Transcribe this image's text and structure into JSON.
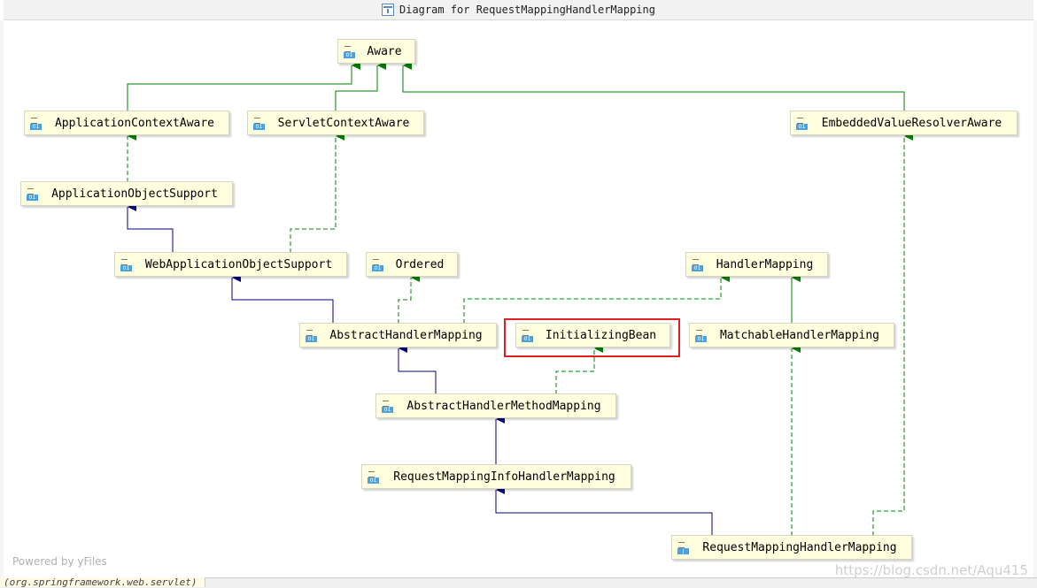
{
  "window": {
    "title": "Diagram for RequestMappingHandlerMapping"
  },
  "colors": {
    "extends": "#000080",
    "implements": "#008000",
    "highlight": "#e02020",
    "node_fill": "#ffffe0"
  },
  "nodes": {
    "aware": "Aware",
    "application_context_aware": "ApplicationContextAware",
    "servlet_context_aware": "ServletContextAware",
    "embedded_value_resolver_aware": "EmbeddedValueResolverAware",
    "application_object_support": "ApplicationObjectSupport",
    "web_application_object_support": "WebApplicationObjectSupport",
    "ordered": "Ordered",
    "handler_mapping": "HandlerMapping",
    "abstract_handler_mapping": "AbstractHandlerMapping",
    "initializing_bean": "InitializingBean",
    "matchable_handler_mapping": "MatchableHandlerMapping",
    "abstract_handler_method_mapping": "AbstractHandlerMethodMapping",
    "request_mapping_info_handler_mapping": "RequestMappingInfoHandlerMapping",
    "request_mapping_handler_mapping": "RequestMappingHandlerMapping"
  },
  "icons": {
    "interface": "01",
    "class": "J"
  },
  "footer": {
    "powered_by": "Powered by yFiles",
    "package_hint": "(org.springframework.web.servlet)",
    "watermark": "https://blog.csdn.net/Aqu415"
  }
}
